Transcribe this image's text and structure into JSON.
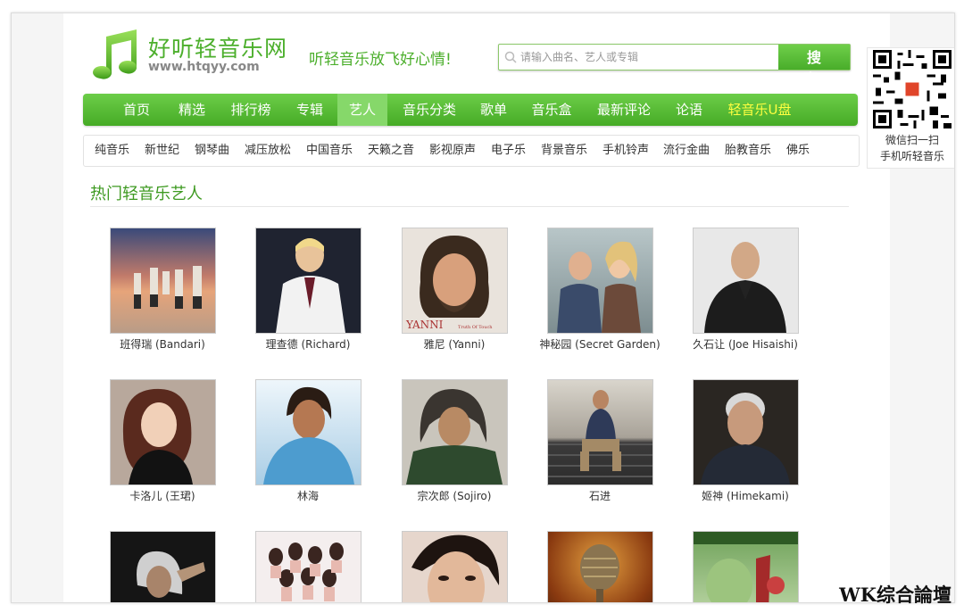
{
  "header": {
    "logo_title": "好听轻音乐网",
    "logo_url": "www.htqyy.com",
    "slogan": "听轻音乐放飞好心情!",
    "search_placeholder": "请输入曲名、艺人或专辑",
    "search_button": "搜 索"
  },
  "nav": {
    "items": [
      "首页",
      "精选",
      "排行榜",
      "专辑",
      "艺人",
      "音乐分类",
      "歌单",
      "音乐盒",
      "最新评论",
      "论语",
      "轻音乐U盘"
    ],
    "active": "艺人",
    "highlight": "轻音乐U盘"
  },
  "subnav": {
    "items": [
      "纯音乐",
      "新世纪",
      "钢琴曲",
      "减压放松",
      "中国音乐",
      "天籁之音",
      "影视原声",
      "电子乐",
      "背景音乐",
      "手机铃声",
      "流行金曲",
      "胎教音乐",
      "佛乐"
    ]
  },
  "section": {
    "title": "热门轻音乐艺人"
  },
  "artists": [
    {
      "name": "班得瑞 (Bandari)"
    },
    {
      "name": "理查德 (Richard)"
    },
    {
      "name": "雅尼 (Yanni)",
      "photo_text": "YANNI",
      "photo_subtext": "Truth Of Touch"
    },
    {
      "name": "神秘园 (Secret Garden)"
    },
    {
      "name": "久石让 (Joe Hisaishi)"
    },
    {
      "name": "卡洛儿 (王珺)"
    },
    {
      "name": "林海"
    },
    {
      "name": "宗次郎 (Sojiro)"
    },
    {
      "name": "石进"
    },
    {
      "name": "姬神 (Himekami)"
    },
    {
      "name": ""
    },
    {
      "name": ""
    },
    {
      "name": ""
    },
    {
      "name": ""
    },
    {
      "name": ""
    }
  ],
  "qr": {
    "line1": "微信扫一扫",
    "line2": "手机听轻音乐"
  },
  "watermark": "WK综合論壇"
}
